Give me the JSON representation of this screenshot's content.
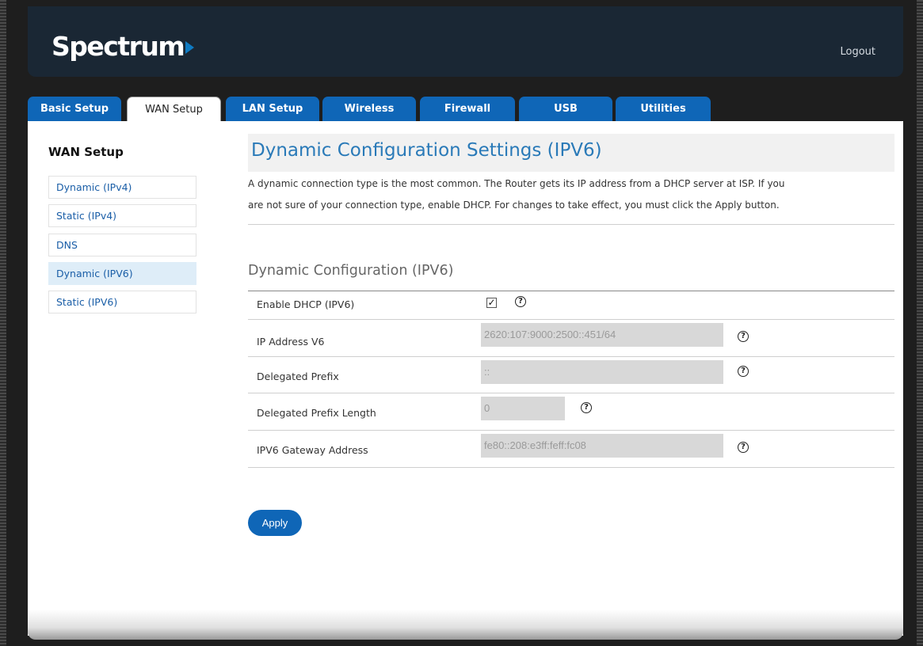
{
  "header": {
    "logo_text": "Spectrum",
    "logout_label": "Logout"
  },
  "tabs": [
    {
      "label": "Basic Setup"
    },
    {
      "label": "WAN Setup",
      "active": true
    },
    {
      "label": "LAN Setup"
    },
    {
      "label": "Wireless"
    },
    {
      "label": "Firewall"
    },
    {
      "label": "USB"
    },
    {
      "label": "Utilities"
    }
  ],
  "sidebar": {
    "title": "WAN Setup",
    "items": [
      {
        "label": "Dynamic (IPv4)"
      },
      {
        "label": "Static (IPv4)"
      },
      {
        "label": "DNS"
      },
      {
        "label": "Dynamic (IPV6)",
        "active": true
      },
      {
        "label": "Static (IPV6)"
      }
    ]
  },
  "main": {
    "title": "Dynamic Configuration Settings (IPV6)",
    "description_line1": "A dynamic connection type is the most common. The Router gets its IP address from a DHCP server at ISP. If you",
    "description_line2": "are not sure of your connection type, enable DHCP. For changes to take effect, you must click the Apply button.",
    "section_title": "Dynamic Configuration (IPV6)",
    "fields": [
      {
        "label": "Enable DHCP (IPV6)",
        "type": "checkbox",
        "checked": true
      },
      {
        "label": "IP Address V6",
        "value": "2620:107:9000:2500::451/64"
      },
      {
        "label": "Delegated Prefix",
        "value": "::"
      },
      {
        "label": "Delegated Prefix Length",
        "value": "0"
      },
      {
        "label": "IPV6 Gateway Address",
        "value": "fe80::208:e3ff:feff:fc08"
      }
    ],
    "help_icon_glyph": "?",
    "checkbox_glyph": "✓",
    "apply_label": "Apply"
  },
  "colors": {
    "brand_blue": "#0f66b7",
    "header_bg": "#1a2734",
    "title_blue": "#2a7ab8"
  }
}
